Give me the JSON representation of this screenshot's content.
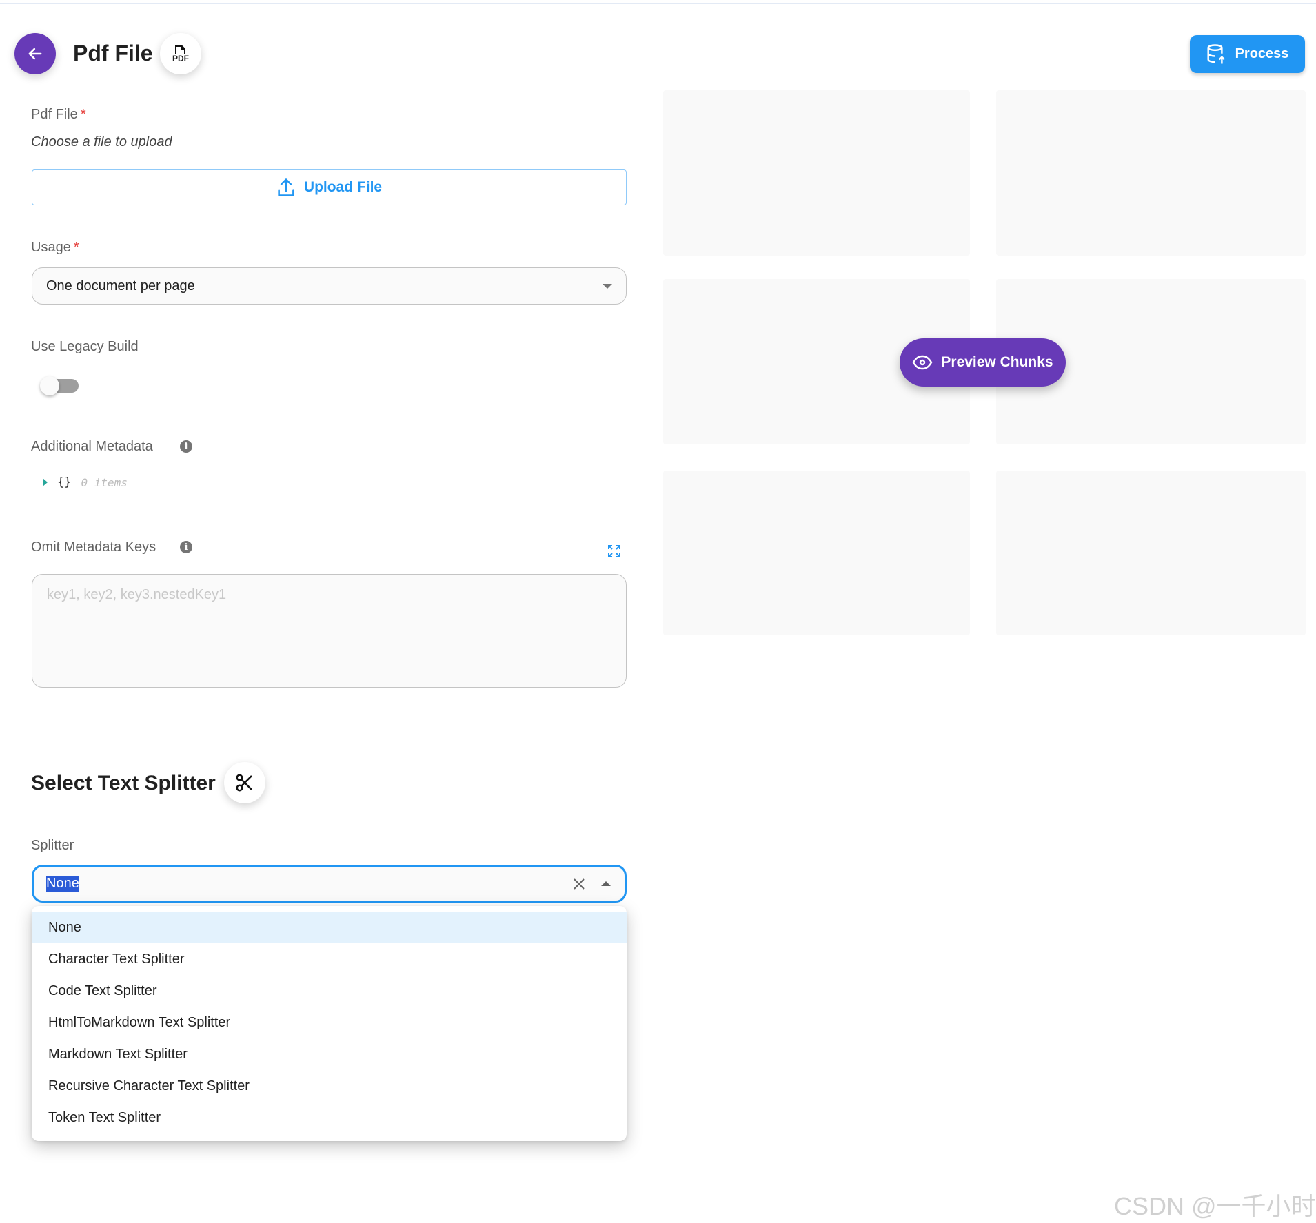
{
  "header": {
    "title": "Pdf File",
    "back_icon": "arrow-left-icon",
    "node_icon": "pdf-file-icon",
    "pdf_icon_text": "PDF",
    "process_label": "Process",
    "process_color": "#2196f3"
  },
  "form": {
    "pdf_file": {
      "label": "Pdf File",
      "required": "*",
      "hint": "Choose a file to upload",
      "upload_label": "Upload File"
    },
    "usage": {
      "label": "Usage",
      "required": "*",
      "value": "One document per page"
    },
    "legacy": {
      "label": "Use Legacy Build",
      "enabled": false
    },
    "metadata": {
      "label": "Additional Metadata",
      "braces": "{}",
      "count": "0 items"
    },
    "omit": {
      "label": "Omit Metadata Keys",
      "placeholder": "key1, key2, key3.nestedKey1"
    }
  },
  "splitter_section": {
    "title": "Select Text Splitter",
    "icon": "scissors-icon",
    "label": "Splitter",
    "value": "None",
    "options": [
      "None",
      "Character Text Splitter",
      "Code Text Splitter",
      "HtmlToMarkdown Text Splitter",
      "Markdown Text Splitter",
      "Recursive Character Text Splitter",
      "Token Text Splitter"
    ]
  },
  "preview": {
    "label": "Preview Chunks",
    "color": "#673ab7"
  },
  "watermark": "CSDN @一千小时"
}
